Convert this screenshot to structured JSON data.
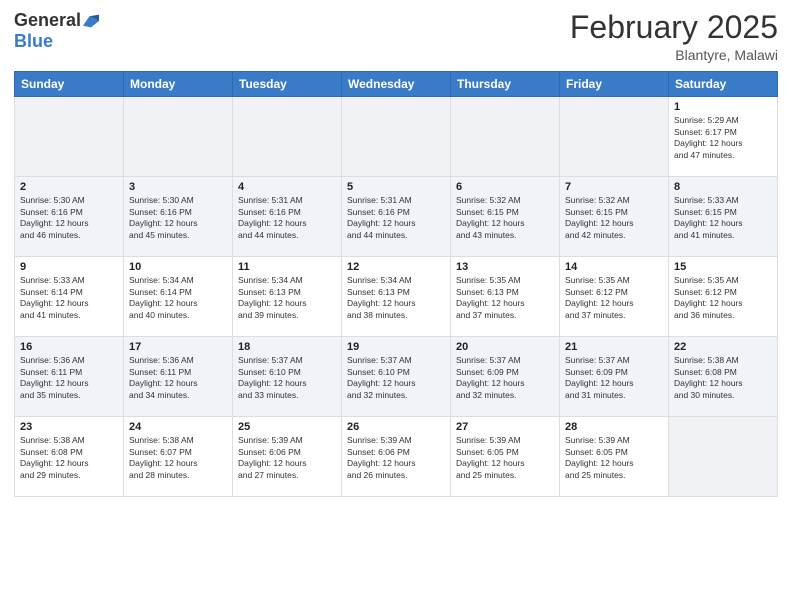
{
  "header": {
    "logo_general": "General",
    "logo_blue": "Blue",
    "month_title": "February 2025",
    "location": "Blantyre, Malawi"
  },
  "days_of_week": [
    "Sunday",
    "Monday",
    "Tuesday",
    "Wednesday",
    "Thursday",
    "Friday",
    "Saturday"
  ],
  "weeks": [
    [
      {
        "day": "",
        "info": ""
      },
      {
        "day": "",
        "info": ""
      },
      {
        "day": "",
        "info": ""
      },
      {
        "day": "",
        "info": ""
      },
      {
        "day": "",
        "info": ""
      },
      {
        "day": "",
        "info": ""
      },
      {
        "day": "1",
        "info": "Sunrise: 5:29 AM\nSunset: 6:17 PM\nDaylight: 12 hours\nand 47 minutes."
      }
    ],
    [
      {
        "day": "2",
        "info": "Sunrise: 5:30 AM\nSunset: 6:16 PM\nDaylight: 12 hours\nand 46 minutes."
      },
      {
        "day": "3",
        "info": "Sunrise: 5:30 AM\nSunset: 6:16 PM\nDaylight: 12 hours\nand 45 minutes."
      },
      {
        "day": "4",
        "info": "Sunrise: 5:31 AM\nSunset: 6:16 PM\nDaylight: 12 hours\nand 44 minutes."
      },
      {
        "day": "5",
        "info": "Sunrise: 5:31 AM\nSunset: 6:16 PM\nDaylight: 12 hours\nand 44 minutes."
      },
      {
        "day": "6",
        "info": "Sunrise: 5:32 AM\nSunset: 6:15 PM\nDaylight: 12 hours\nand 43 minutes."
      },
      {
        "day": "7",
        "info": "Sunrise: 5:32 AM\nSunset: 6:15 PM\nDaylight: 12 hours\nand 42 minutes."
      },
      {
        "day": "8",
        "info": "Sunrise: 5:33 AM\nSunset: 6:15 PM\nDaylight: 12 hours\nand 41 minutes."
      }
    ],
    [
      {
        "day": "9",
        "info": "Sunrise: 5:33 AM\nSunset: 6:14 PM\nDaylight: 12 hours\nand 41 minutes."
      },
      {
        "day": "10",
        "info": "Sunrise: 5:34 AM\nSunset: 6:14 PM\nDaylight: 12 hours\nand 40 minutes."
      },
      {
        "day": "11",
        "info": "Sunrise: 5:34 AM\nSunset: 6:13 PM\nDaylight: 12 hours\nand 39 minutes."
      },
      {
        "day": "12",
        "info": "Sunrise: 5:34 AM\nSunset: 6:13 PM\nDaylight: 12 hours\nand 38 minutes."
      },
      {
        "day": "13",
        "info": "Sunrise: 5:35 AM\nSunset: 6:13 PM\nDaylight: 12 hours\nand 37 minutes."
      },
      {
        "day": "14",
        "info": "Sunrise: 5:35 AM\nSunset: 6:12 PM\nDaylight: 12 hours\nand 37 minutes."
      },
      {
        "day": "15",
        "info": "Sunrise: 5:35 AM\nSunset: 6:12 PM\nDaylight: 12 hours\nand 36 minutes."
      }
    ],
    [
      {
        "day": "16",
        "info": "Sunrise: 5:36 AM\nSunset: 6:11 PM\nDaylight: 12 hours\nand 35 minutes."
      },
      {
        "day": "17",
        "info": "Sunrise: 5:36 AM\nSunset: 6:11 PM\nDaylight: 12 hours\nand 34 minutes."
      },
      {
        "day": "18",
        "info": "Sunrise: 5:37 AM\nSunset: 6:10 PM\nDaylight: 12 hours\nand 33 minutes."
      },
      {
        "day": "19",
        "info": "Sunrise: 5:37 AM\nSunset: 6:10 PM\nDaylight: 12 hours\nand 32 minutes."
      },
      {
        "day": "20",
        "info": "Sunrise: 5:37 AM\nSunset: 6:09 PM\nDaylight: 12 hours\nand 32 minutes."
      },
      {
        "day": "21",
        "info": "Sunrise: 5:37 AM\nSunset: 6:09 PM\nDaylight: 12 hours\nand 31 minutes."
      },
      {
        "day": "22",
        "info": "Sunrise: 5:38 AM\nSunset: 6:08 PM\nDaylight: 12 hours\nand 30 minutes."
      }
    ],
    [
      {
        "day": "23",
        "info": "Sunrise: 5:38 AM\nSunset: 6:08 PM\nDaylight: 12 hours\nand 29 minutes."
      },
      {
        "day": "24",
        "info": "Sunrise: 5:38 AM\nSunset: 6:07 PM\nDaylight: 12 hours\nand 28 minutes."
      },
      {
        "day": "25",
        "info": "Sunrise: 5:39 AM\nSunset: 6:06 PM\nDaylight: 12 hours\nand 27 minutes."
      },
      {
        "day": "26",
        "info": "Sunrise: 5:39 AM\nSunset: 6:06 PM\nDaylight: 12 hours\nand 26 minutes."
      },
      {
        "day": "27",
        "info": "Sunrise: 5:39 AM\nSunset: 6:05 PM\nDaylight: 12 hours\nand 25 minutes."
      },
      {
        "day": "28",
        "info": "Sunrise: 5:39 AM\nSunset: 6:05 PM\nDaylight: 12 hours\nand 25 minutes."
      },
      {
        "day": "",
        "info": ""
      }
    ]
  ]
}
